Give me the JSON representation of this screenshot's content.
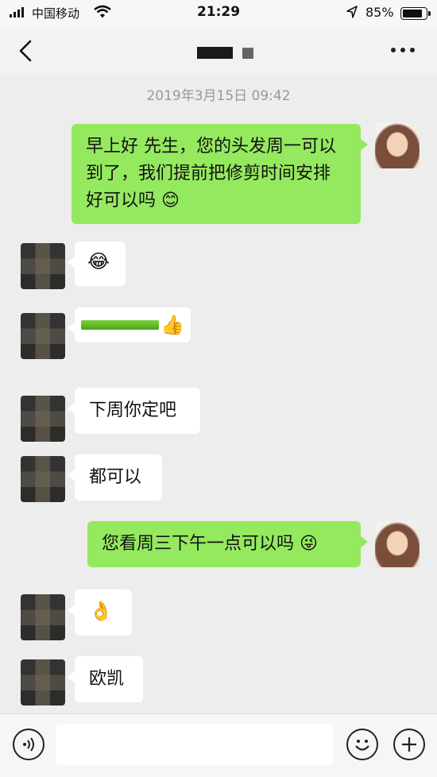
{
  "status_bar": {
    "carrier": "中国移动",
    "time": "21:29",
    "battery_text": "85%",
    "battery_level": 0.85
  },
  "nav": {
    "back_icon": "chevron-left-icon",
    "more_icon": "more-dots-icon"
  },
  "chat": {
    "timestamp": "2019年3月15日 09:42",
    "messages": [
      {
        "sender": "me",
        "text": "早上好 先生，您的头发周一可以到了，我们提前把修剪时间安排好可以吗 😊"
      },
      {
        "sender": "other",
        "text": "😂"
      },
      {
        "sender": "other",
        "text": "👍",
        "progress": 1.0
      },
      {
        "sender": "other",
        "text": "下周你定吧"
      },
      {
        "sender": "other",
        "text": "都可以"
      },
      {
        "sender": "me",
        "text": "您看周三下午一点可以吗 😜"
      },
      {
        "sender": "other",
        "text": "👌"
      },
      {
        "sender": "other",
        "text": "欧凯"
      }
    ]
  },
  "input_bar": {
    "voice_icon": "voice-icon",
    "emoji_icon": "emoji-icon",
    "plus_icon": "plus-icon",
    "value": "",
    "placeholder": ""
  },
  "colors": {
    "my_bubble": "#95e95f",
    "other_bubble": "#ffffff",
    "background": "#ededed",
    "timestamp": "#999999"
  }
}
